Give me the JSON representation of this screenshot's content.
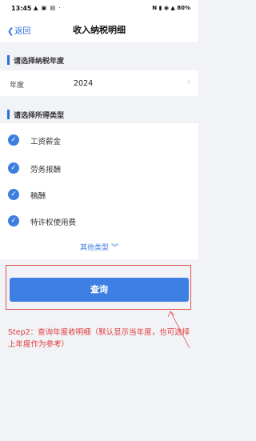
{
  "status_bar": {
    "time": "13:45",
    "left_icons": "▲ ▣ ▤ ·",
    "right_icons": "N ▮ ◉ ▲ 80%"
  },
  "nav": {
    "back_label": "返回",
    "title": "收入纳税明细"
  },
  "year_section": {
    "header": "请选择纳税年度",
    "label": "年度",
    "value": "2024"
  },
  "type_section": {
    "header": "请选择所得类型",
    "items": [
      {
        "label": "工资薪金",
        "checked": true
      },
      {
        "label": "劳务报酬",
        "checked": true
      },
      {
        "label": "稿酬",
        "checked": true
      },
      {
        "label": "特许权使用费",
        "checked": true
      }
    ],
    "more_label": "其他类型",
    "more_icon": "double-chevron-down-icon"
  },
  "query_button": {
    "label": "查询",
    "color": "#3d7fe3"
  },
  "annotation": {
    "text": "Step2：查询年度收明细（默认显示当年度，也可选择上年度作为参考）",
    "color": "#e03b3b"
  }
}
